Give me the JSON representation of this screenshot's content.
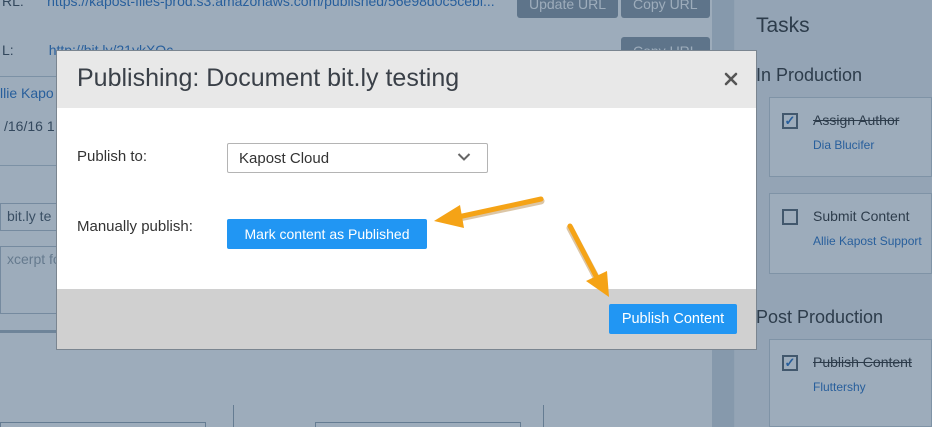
{
  "background": {
    "url_row": {
      "label": "RL:",
      "value": "https://kapost-files-prod.s3.amazonaws.com/published/56e98d0c5cebl...",
      "update_button": "Update URL",
      "copy_button": "Copy URL"
    },
    "short_url_row": {
      "label": "L:",
      "value": "http://bit.ly/21ykXOc",
      "copy_button": "Copy URL"
    },
    "author_fragment": "llie Kapo",
    "date_fragment": "/16/16 1",
    "title_input_fragment": "bit.ly te",
    "excerpt_placeholder_fragment": "xcerpt fo"
  },
  "tasks": {
    "title": "Tasks",
    "sections": [
      {
        "name": "In Production",
        "items": [
          {
            "name": "Assign Author",
            "assignee": "Dia Blucifer",
            "done": true
          },
          {
            "name": "Submit Content",
            "assignee": "Allie Kapost Support",
            "done": false
          }
        ]
      },
      {
        "name": "Post Production",
        "items": [
          {
            "name": "Publish Content",
            "assignee": "Fluttershy",
            "done": true
          }
        ]
      }
    ]
  },
  "modal": {
    "title": "Publishing: Document bit.ly testing",
    "publish_to_label": "Publish to:",
    "publish_to_value": "Kapost Cloud",
    "manual_label": "Manually publish:",
    "mark_button": "Mark content as Published",
    "publish_button": "Publish Content",
    "check_glyph": "✓"
  },
  "colors": {
    "accent": "#2196f3",
    "annotation_arrow": "#f5a316",
    "overlay": "#264669"
  }
}
